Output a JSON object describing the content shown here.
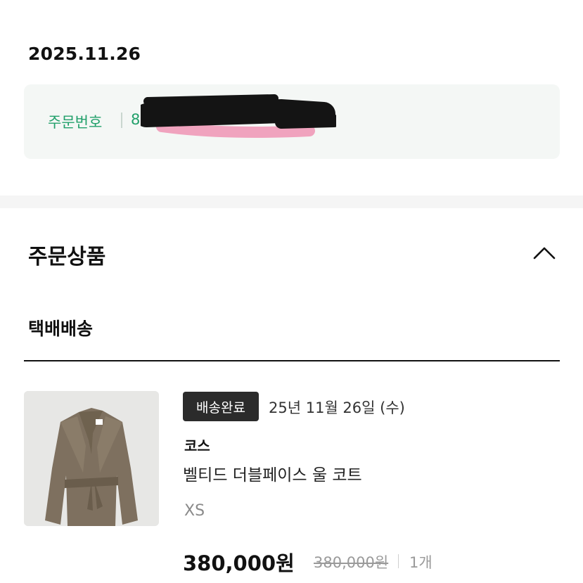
{
  "order": {
    "date": "2025.11.26",
    "number_label": "주문번호",
    "number_value": "8",
    "number_redacted": true
  },
  "section": {
    "title": "주문상품",
    "collapse_icon": "chevron-up-icon",
    "delivery_type": "택배배송"
  },
  "product": {
    "status": "배송완료",
    "delivery_date": "25년 11월 26일 (수)",
    "brand": "코스",
    "name": "벨티드 더블페이스 울 코트",
    "option": "XS",
    "price": "380,000원",
    "original_price": "380,000원",
    "quantity": "1개",
    "image": "coat-image"
  },
  "colors": {
    "accent_green": "#22a06b",
    "order_box_bg": "#f4f7f5",
    "badge_bg": "#2b2b2b",
    "muted": "#9a9a9a"
  }
}
